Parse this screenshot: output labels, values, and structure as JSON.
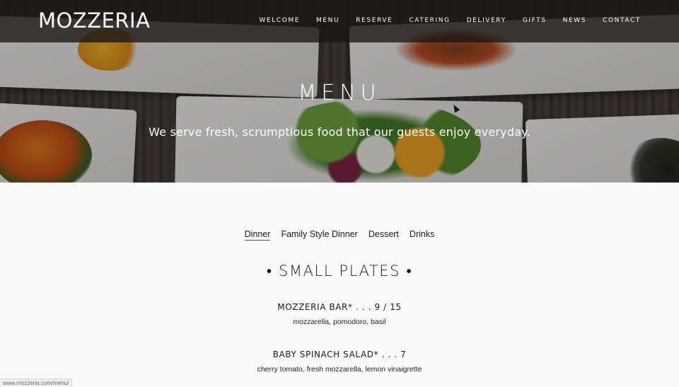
{
  "header": {
    "logo": "MOZZERIA",
    "nav": [
      "WELCOME",
      "MENU",
      "RESERVE",
      "CATERING",
      "DELIVERY",
      "GIFTS",
      "NEWS",
      "CONTACT"
    ]
  },
  "hero": {
    "title": "MENU",
    "subtitle": "We serve fresh, scrumptious food that our guests enjoy everyday."
  },
  "menu_tabs": {
    "items": [
      "Dinner",
      "Family Style Dinner",
      "Dessert",
      "Drinks"
    ],
    "active": "Dinner"
  },
  "section": {
    "title": "• SMALL PLATES •",
    "items": [
      {
        "name": "MOZZERIA BAR* . . . 9 / 15",
        "description": "mozzarella, pomodoro, basil"
      },
      {
        "name": "BABY SPINACH SALAD* . . . 7",
        "description": "cherry tomato, fresh mozzarella, lemon vinaigrette"
      }
    ]
  },
  "status_bar": {
    "url": "www.mozzeria.com/menu/"
  },
  "colors": {
    "background": "#fafafb",
    "header_bar": "#191614",
    "text": "#1a1a1a"
  }
}
